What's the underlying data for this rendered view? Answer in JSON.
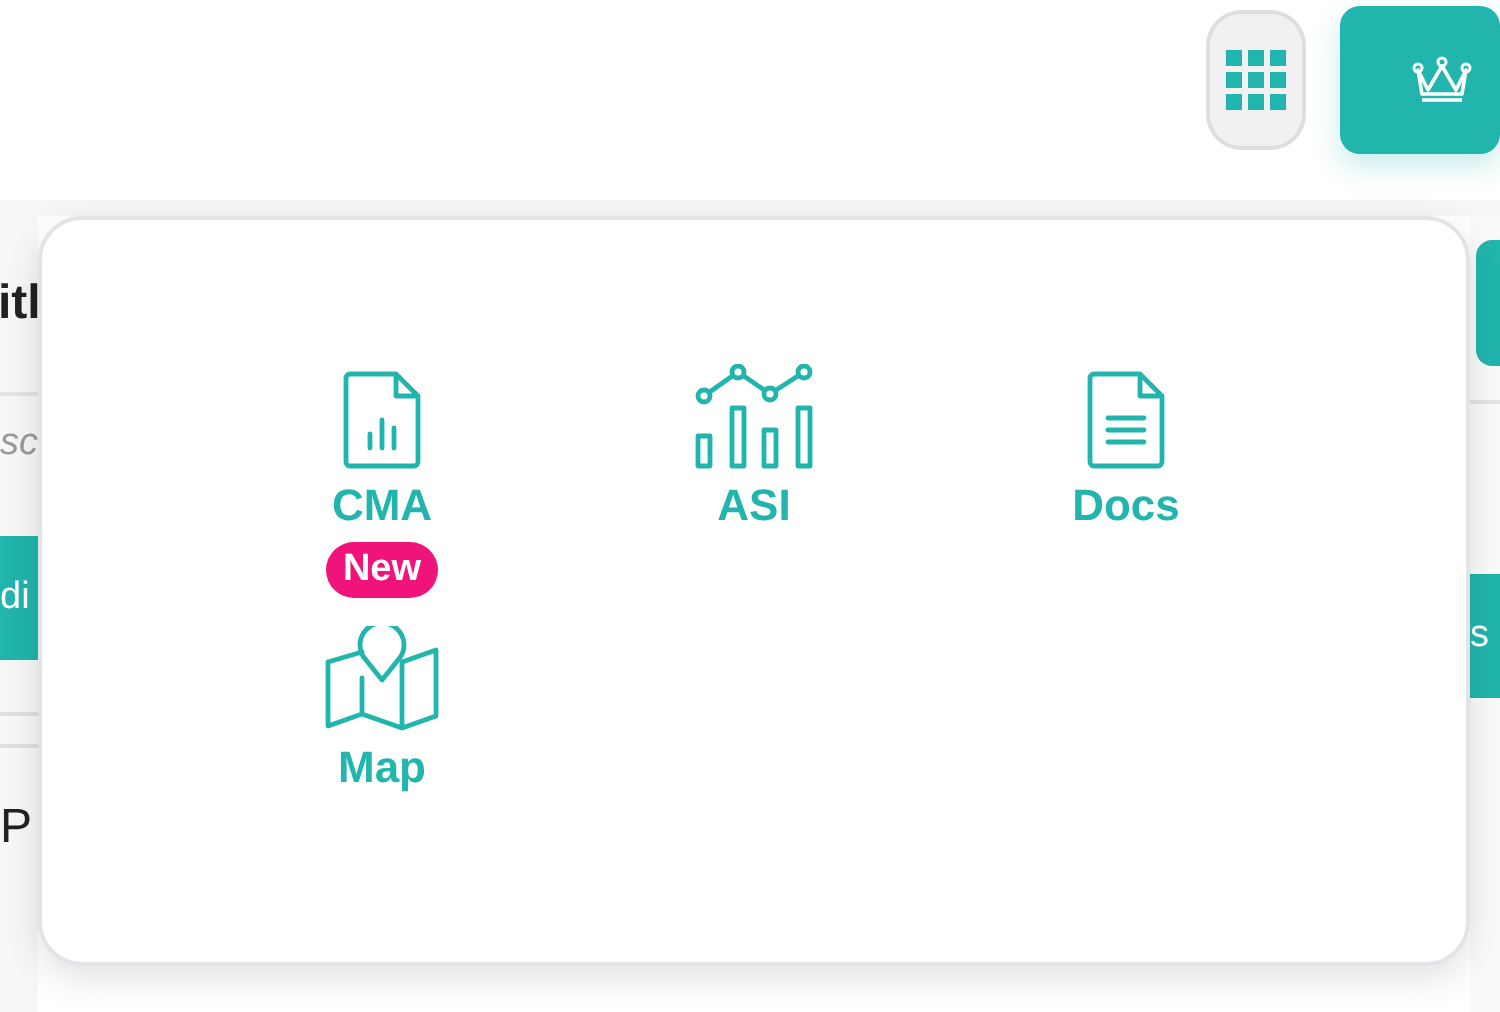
{
  "background": {
    "heading": "itl",
    "hint": "sc",
    "bar_left": "di",
    "bar_right": "s",
    "text": "P"
  },
  "apps_menu": {
    "items": [
      {
        "kind": "report",
        "label": "CMA",
        "badge": "New"
      },
      {
        "kind": "chart",
        "label": "ASI"
      },
      {
        "kind": "document",
        "label": "Docs"
      },
      {
        "kind": "map",
        "label": "Map"
      }
    ]
  }
}
